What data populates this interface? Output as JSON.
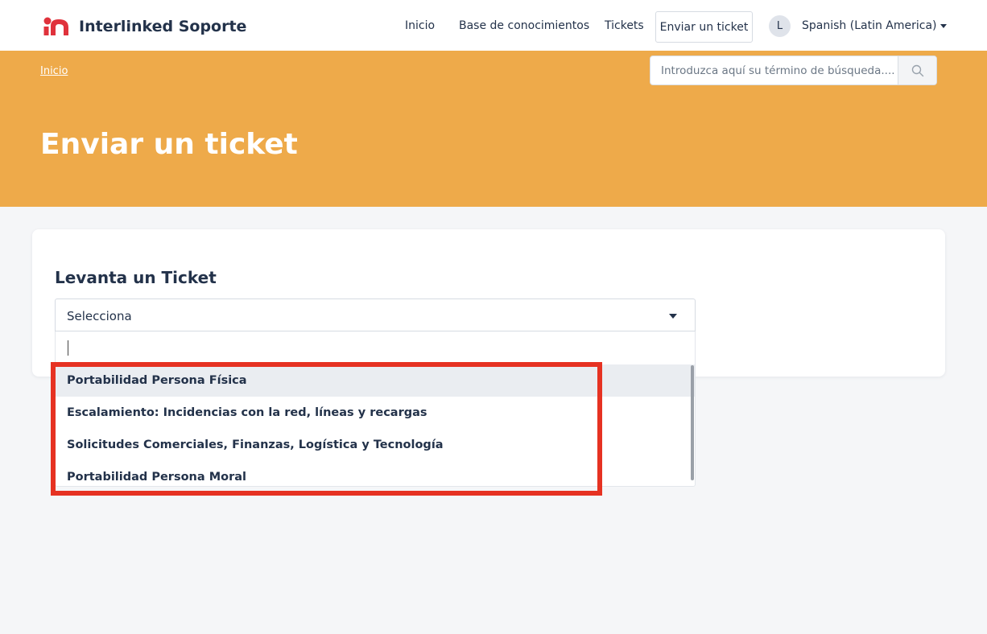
{
  "header": {
    "brand_name": "Interlinked Soporte",
    "nav": {
      "inicio": "Inicio",
      "base": "Base de conocimientos",
      "tickets": "Tickets",
      "send_ticket": "Enviar un ticket"
    },
    "avatar_initial": "L",
    "language": "Spanish (Latin America)"
  },
  "banner": {
    "breadcrumb": "Inicio",
    "search_placeholder": "Introduzca aquí su término de búsqueda....",
    "title": "Enviar un ticket"
  },
  "form": {
    "title": "Levanta un Ticket",
    "select_value": "Selecciona",
    "options": [
      "Portabilidad Persona Física",
      "Escalamiento: Incidencias con la red, líneas y recargas",
      "Solicitudes Comerciales, Finanzas, Logística y Tecnología",
      "Portabilidad Persona Moral"
    ]
  },
  "colors": {
    "brand_red": "#e0323c",
    "banner": "#eeaa4a",
    "highlight": "#e63222",
    "text": "#23324a"
  }
}
